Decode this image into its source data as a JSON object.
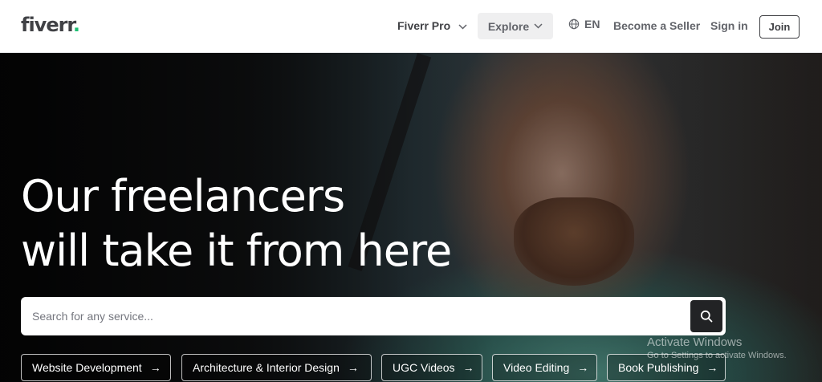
{
  "header": {
    "logo_text": "fiverr",
    "logo_dot": ".",
    "nav": {
      "fiverr_pro": "Fiverr Pro",
      "explore": "Explore",
      "language": "EN",
      "become_seller": "Become a Seller",
      "sign_in": "Sign in",
      "join": "Join"
    }
  },
  "hero": {
    "headline_line1": "Our freelancers",
    "headline_line2": "will take it from here",
    "search": {
      "placeholder": "Search for any service...",
      "value": ""
    },
    "chips": [
      {
        "label": "Website Development"
      },
      {
        "label": "Architecture & Interior Design"
      },
      {
        "label": "UGC Videos"
      },
      {
        "label": "Video Editing"
      },
      {
        "label": "Book Publishing"
      }
    ]
  },
  "os_watermark": {
    "title": "Activate Windows",
    "subtitle": "Go to Settings to activate Windows."
  },
  "colors": {
    "brand_green": "#1dbf73",
    "text_dark": "#404145",
    "text_muted": "#62646a",
    "search_button": "#222325"
  }
}
